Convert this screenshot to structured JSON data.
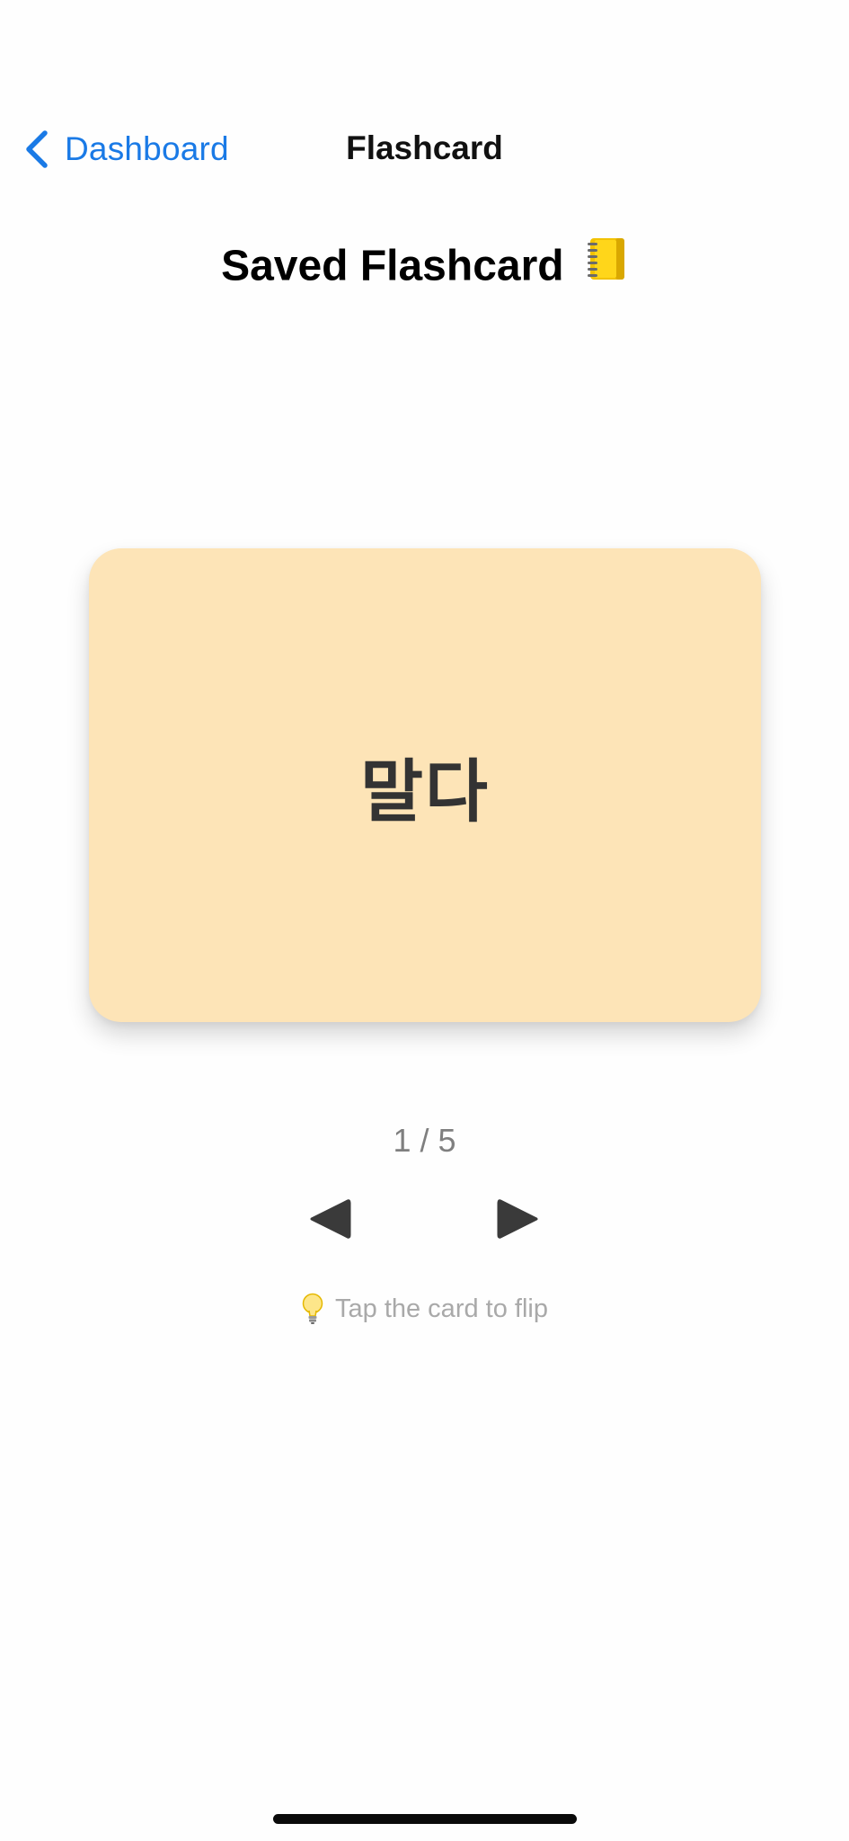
{
  "nav": {
    "back_label": "Dashboard",
    "title": "Flashcard",
    "back_icon": "chevron-left-icon"
  },
  "page": {
    "title": "Saved Flashcard",
    "title_icon": "notebook-icon"
  },
  "card": {
    "word": "말다",
    "background": "#fde4b7"
  },
  "pagination": {
    "counter": "1 / 5",
    "current": 1,
    "total": 5,
    "prev_icon": "triangle-left-icon",
    "next_icon": "triangle-right-icon"
  },
  "hint": {
    "text": "Tap the card to flip",
    "icon": "lightbulb-icon"
  },
  "colors": {
    "accent": "#1a7ae6",
    "card": "#fde4b7",
    "arrow": "#3a3a3a"
  }
}
